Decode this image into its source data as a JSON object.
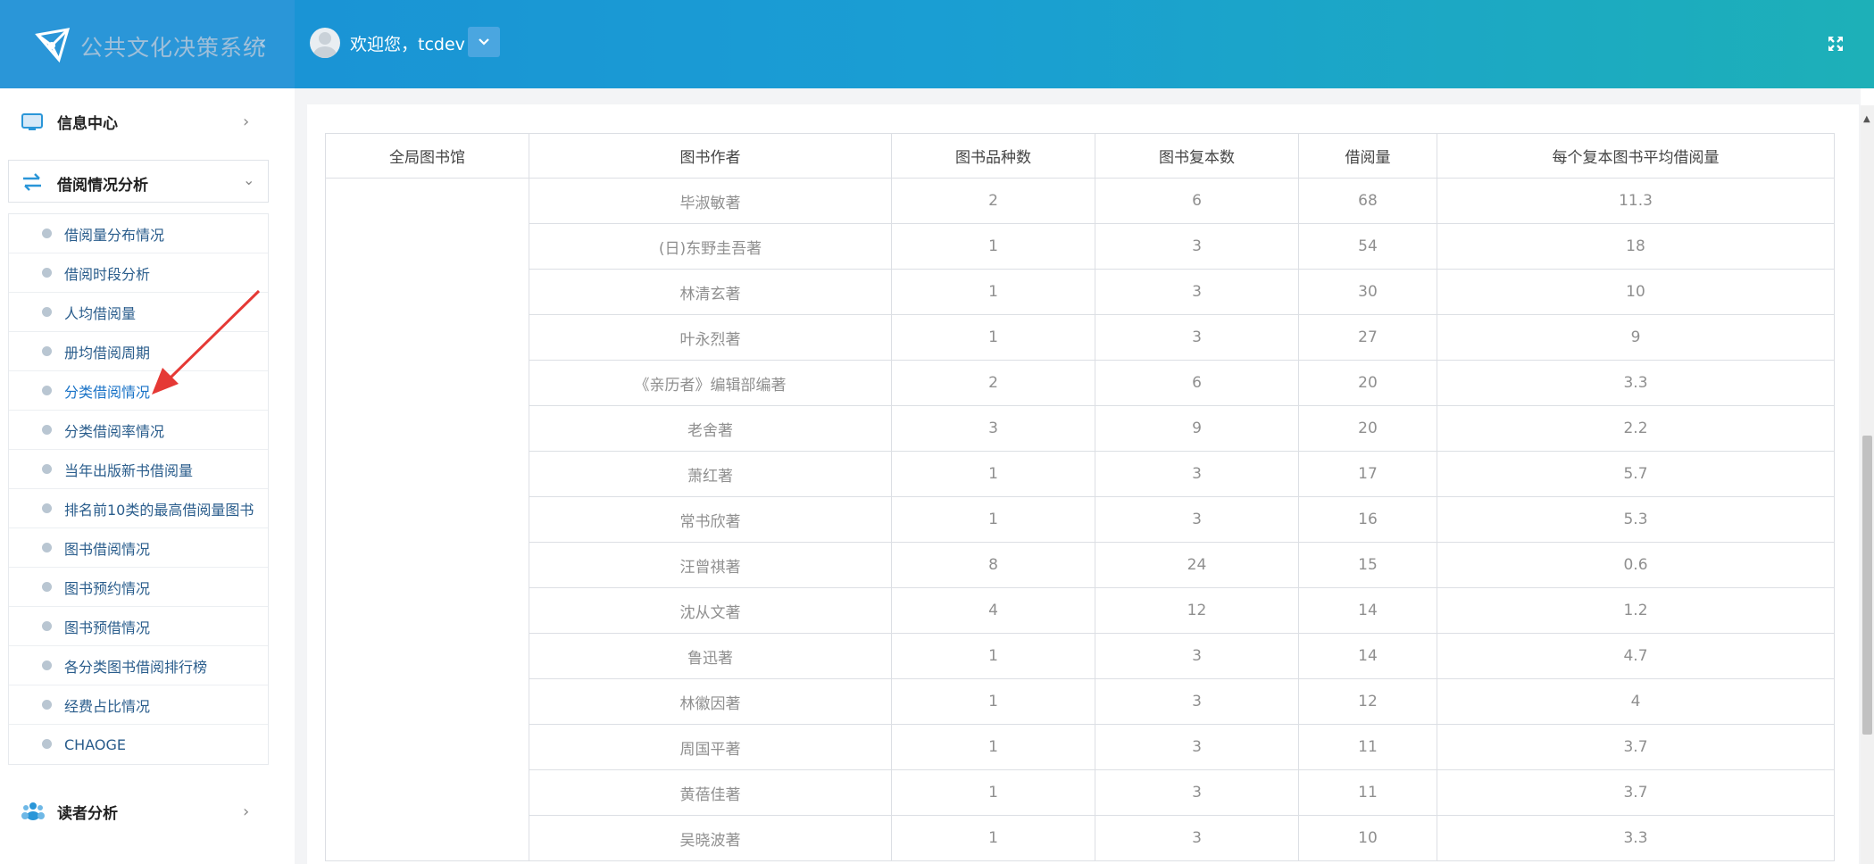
{
  "header": {
    "brand_title": "公共文化决策系统",
    "collapse_icon": "chevron-left-icon",
    "welcome_text": "欢迎您，tcdev",
    "fullscreen_icon": "expand-icon",
    "colors": {
      "brand_bg": "#2a96d8",
      "gradient_end": "#1db0b8"
    }
  },
  "sidebar": {
    "menus": [
      {
        "label": "信息中心",
        "icon": "monitor-icon"
      },
      {
        "label": "借阅情况分析",
        "icon": "swap-arrows-icon",
        "expanded": true
      },
      {
        "label": "读者分析",
        "icon": "users-icon"
      }
    ],
    "submenu": [
      "借阅量分布情况",
      "借阅时段分析",
      "人均借阅量",
      "册均借阅周期",
      "分类借阅情况",
      "分类借阅率情况",
      "当年出版新书借阅量",
      "排名前10类的最高借阅量图书",
      "图书借阅情况",
      "图书预约情况",
      "图书预借情况",
      "各分类图书借阅排行榜",
      "经费占比情况",
      "CHAOGE"
    ],
    "active_item": "分类借阅情况",
    "accent_color": "#e53935"
  },
  "table": {
    "columns": [
      "全局图书馆",
      "图书作者",
      "图书品种数",
      "图书复本数",
      "借阅量",
      "每个复本图书平均借阅量"
    ],
    "rows": [
      [
        "毕淑敏著",
        "2",
        "6",
        "68",
        "11.3"
      ],
      [
        "(日)东野圭吾著",
        "1",
        "3",
        "54",
        "18"
      ],
      [
        "林清玄著",
        "1",
        "3",
        "30",
        "10"
      ],
      [
        "叶永烈著",
        "1",
        "3",
        "27",
        "9"
      ],
      [
        "《亲历者》编辑部编著",
        "2",
        "6",
        "20",
        "3.3"
      ],
      [
        "老舍著",
        "3",
        "9",
        "20",
        "2.2"
      ],
      [
        "萧红著",
        "1",
        "3",
        "17",
        "5.7"
      ],
      [
        "常书欣著",
        "1",
        "3",
        "16",
        "5.3"
      ],
      [
        "汪曾祺著",
        "8",
        "24",
        "15",
        "0.6"
      ],
      [
        "沈从文著",
        "4",
        "12",
        "14",
        "1.2"
      ],
      [
        "鲁迅著",
        "1",
        "3",
        "14",
        "4.7"
      ],
      [
        "林徽因著",
        "1",
        "3",
        "12",
        "4"
      ],
      [
        "周国平著",
        "1",
        "3",
        "11",
        "3.7"
      ],
      [
        "黄蓓佳著",
        "1",
        "3",
        "11",
        "3.7"
      ],
      [
        "吴晓波著",
        "1",
        "3",
        "10",
        "3.3"
      ]
    ]
  }
}
